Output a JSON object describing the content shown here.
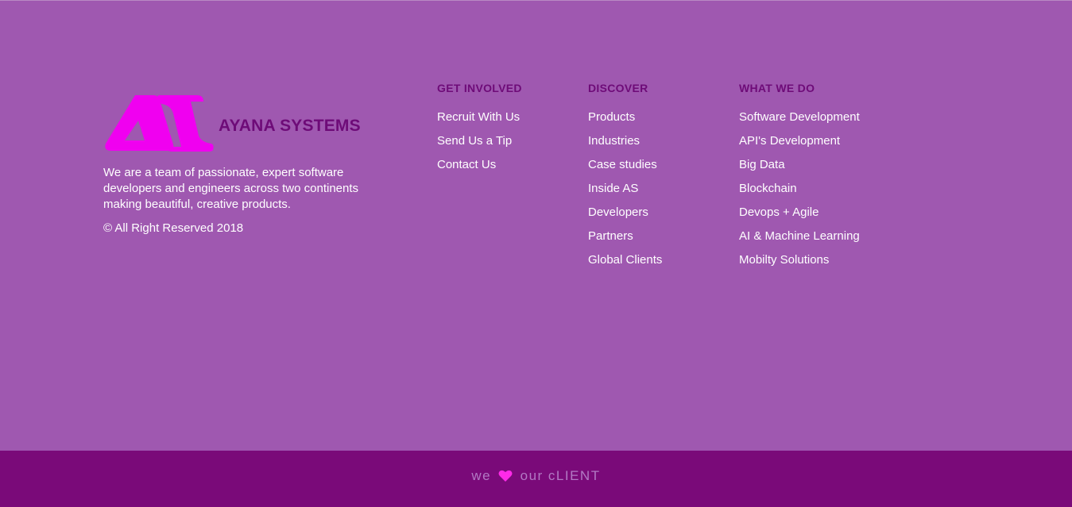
{
  "brand": {
    "name": "AYANA SYSTEMS",
    "about": "We are a team of passionate, expert software developers and engineers across two continents making beautiful, creative products.",
    "copyright": "© All Right Reserved 2018"
  },
  "columns": [
    {
      "title": "GET INVOLVED",
      "links": [
        "Recruit With Us",
        "Send Us a Tip",
        "Contact Us"
      ]
    },
    {
      "title": "DISCOVER",
      "links": [
        "Products",
        "Industries",
        "Case studies",
        "Inside AS",
        "Developers",
        "Partners",
        "Global Clients"
      ]
    },
    {
      "title": "WHAT WE DO",
      "links": [
        "Software Development",
        "API's Development",
        "Big Data",
        "Blockchain",
        "Devops + Agile",
        "AI & Machine Learning",
        "Mobilty Solutions"
      ]
    }
  ],
  "bottom_bar": {
    "tagline_before": "we",
    "tagline_after": "our cLIENT",
    "heart_icon": "heart-icon"
  },
  "colors": {
    "background": "#9f58b0",
    "heading": "#6e0b78",
    "logo": "#f000f0",
    "bottom_bar": "#7a0a79",
    "tagline": "#b279c4",
    "heart": "#ff2ae8"
  }
}
